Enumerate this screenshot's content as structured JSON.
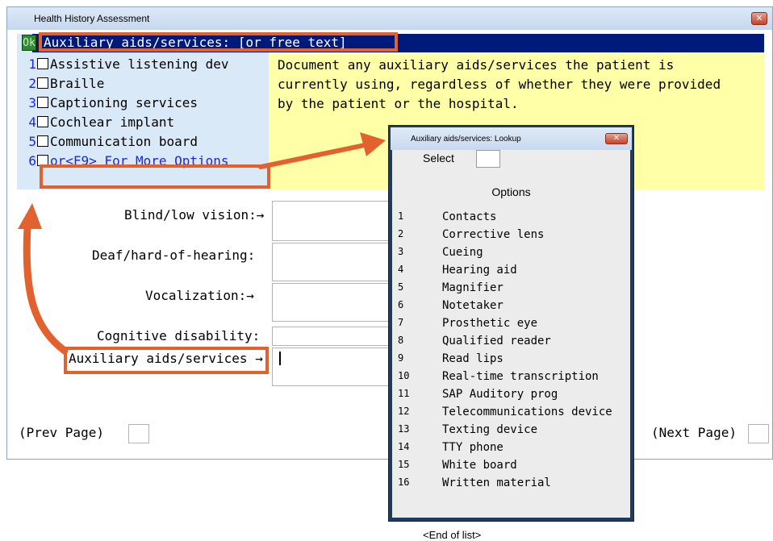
{
  "window": {
    "title": "Health History Assessment",
    "close_glyph": "✕"
  },
  "header": {
    "ok_label": "Ok",
    "title": "Auxiliary aids/services: [or free text]"
  },
  "options": [
    {
      "num": "1",
      "label": "Assistive listening dev"
    },
    {
      "num": "2",
      "label": "Braille"
    },
    {
      "num": "3",
      "label": "Captioning services"
    },
    {
      "num": "4",
      "label": "Cochlear implant"
    },
    {
      "num": "5",
      "label": "Communication board"
    },
    {
      "num": "6",
      "label": "or<F9> For More Options"
    }
  ],
  "description": [
    "Document any auxiliary aids/services the patient is",
    "currently using, regardless of whether they were provided",
    "by the patient or the hospital."
  ],
  "form": {
    "blind_label": "Blind/low vision:→",
    "deaf_label": "Deaf/hard-of-hearing:",
    "vocalization_label": "Vocalization:→",
    "cognitive_label": "Cognitive disability:",
    "auxiliary_label": "Auxiliary aids/services →",
    "prev_page": "(Prev Page)",
    "next_page": "(Next Page)"
  },
  "lookup": {
    "title": "Auxiliary aids/services: Lookup",
    "close_glyph": "✕",
    "select_label": "Select",
    "options_label": "Options",
    "items": [
      {
        "num": "1",
        "label": "Contacts"
      },
      {
        "num": "2",
        "label": "Corrective lens"
      },
      {
        "num": "3",
        "label": "Cueing"
      },
      {
        "num": "4",
        "label": "Hearing aid"
      },
      {
        "num": "5",
        "label": "Magnifier"
      },
      {
        "num": "6",
        "label": "Notetaker"
      },
      {
        "num": "7",
        "label": "Prosthetic eye"
      },
      {
        "num": "8",
        "label": "Qualified reader"
      },
      {
        "num": "9",
        "label": "Read lips"
      },
      {
        "num": "10",
        "label": "Real-time transcription"
      },
      {
        "num": "11",
        "label": "SAP Auditory prog"
      },
      {
        "num": "12",
        "label": "Telecommunications device"
      },
      {
        "num": "13",
        "label": "Texting device"
      },
      {
        "num": "14",
        "label": "TTY phone"
      },
      {
        "num": "15",
        "label": "White board"
      },
      {
        "num": "16",
        "label": "Written material"
      }
    ],
    "end_label": "<End of list>"
  },
  "colors": {
    "highlight": "#e2622f",
    "header_bg": "#001a7c",
    "option_panel": "#d9e9f8",
    "description_panel": "#ffffa8"
  }
}
